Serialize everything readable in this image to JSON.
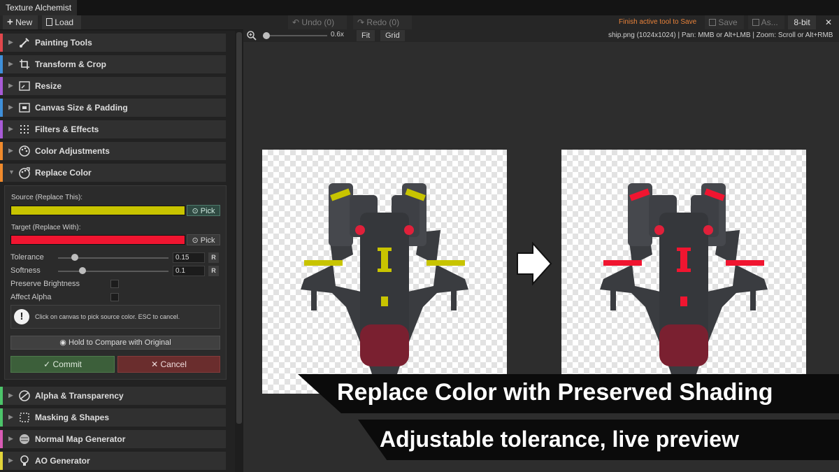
{
  "app": {
    "title": "Texture Alchemist"
  },
  "toolbar": {
    "new_label": "New",
    "load_label": "Load",
    "undo_label": "Undo (0)",
    "redo_label": "Redo (0)",
    "finish_msg": "Finish active tool to Save",
    "save_label": "Save",
    "saveas_label": "As...",
    "bitdepth": "8-bit",
    "close_glyph": "✕"
  },
  "sidebar": {
    "sections": [
      {
        "label": "Painting Tools",
        "color": "#e0474c",
        "icon": "brush-icon",
        "expanded": false
      },
      {
        "label": "Transform & Crop",
        "color": "#3f8fd9",
        "icon": "crop-icon",
        "expanded": false
      },
      {
        "label": "Resize",
        "color": "#a85bd6",
        "icon": "resize-icon",
        "expanded": false
      },
      {
        "label": "Canvas Size & Padding",
        "color": "#3f8fd9",
        "icon": "canvas-size-icon",
        "expanded": false
      },
      {
        "label": "Filters & Effects",
        "color": "#a85bd6",
        "icon": "filter-grid-icon",
        "expanded": false
      },
      {
        "label": "Color Adjustments",
        "color": "#f08a2c",
        "icon": "palette-icon",
        "expanded": false
      },
      {
        "label": "Replace Color",
        "color": "#f08a2c",
        "icon": "replace-color-icon",
        "expanded": true
      },
      {
        "label": "Alpha & Transparency",
        "color": "#4cc46a",
        "icon": "alpha-icon",
        "expanded": false
      },
      {
        "label": "Masking & Shapes",
        "color": "#4cc46a",
        "icon": "mask-shapes-icon",
        "expanded": false
      },
      {
        "label": "Normal Map Generator",
        "color": "#d85bb4",
        "icon": "normal-map-icon",
        "expanded": false
      },
      {
        "label": "AO Generator",
        "color": "#e2d43a",
        "icon": "bulb-icon",
        "expanded": false
      }
    ]
  },
  "replace_color": {
    "source_label": "Source (Replace This):",
    "source_color": "#c8c400",
    "target_label": "Target (Replace With):",
    "target_color": "#f01530",
    "pick_label": "Pick",
    "tolerance_label": "Tolerance",
    "tolerance_value": "0.15",
    "tolerance_fraction": 0.15,
    "softness_label": "Softness",
    "softness_value": "0.1",
    "softness_fraction": 0.22,
    "reset_label": "R",
    "preserve_label": "Preserve Brightness",
    "preserve_checked": false,
    "alpha_label": "Affect Alpha",
    "alpha_checked": false,
    "info_text": "Click on canvas to pick source color. ESC to cancel.",
    "compare_label": "Hold to Compare with Original",
    "commit_label": "✓ Commit",
    "cancel_label": "✕ Cancel"
  },
  "canvas_bar": {
    "zoom_value": "0.6x",
    "zoom_fraction": 0.05,
    "fit_label": "Fit",
    "grid_label": "Grid",
    "file_info": "ship.png (1024x1024)  |   Pan: MMB or Alt+LMB | Zoom: Scroll or Alt+RMB"
  },
  "captions": {
    "headline": "Replace Color with Preserved Shading",
    "subline": "Adjustable tolerance, live preview"
  },
  "colors": {
    "accent_before": "#c8c400",
    "accent_after": "#f01530"
  }
}
